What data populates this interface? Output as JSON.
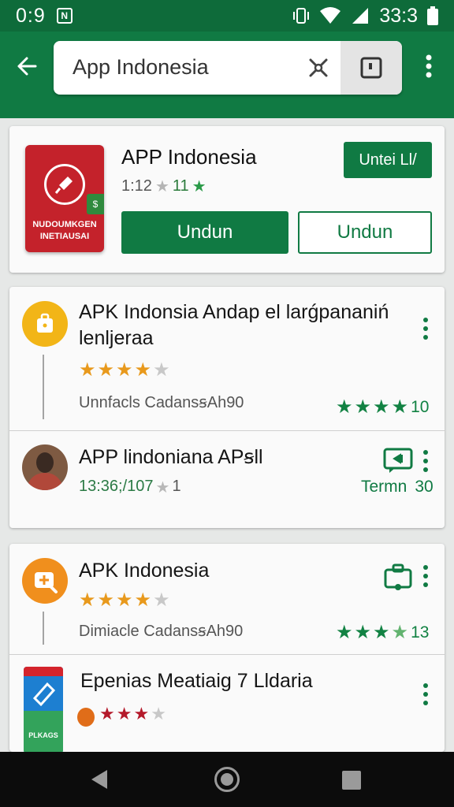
{
  "status_bar": {
    "time": "0:9",
    "notification": "N",
    "clock": "33:3"
  },
  "search": {
    "query": "App Indonesia"
  },
  "featured": {
    "title": "APP Indonesia",
    "meta": "1:12",
    "meta_rating": "11",
    "icon_text": "NUDOUMKGEN INETIAUSAI",
    "icon_badge": "$",
    "small_button": "Untei Ll/",
    "primary_button": "Undun",
    "secondary_button": "Undun"
  },
  "list": [
    {
      "title": "APK Indonsia Andap el larǵpananiń lenljeraa",
      "subtitle": "Unnfacls CadansꞩAh90",
      "rating_stars": 4,
      "right_rating": "10",
      "icon": "briefcase-icon"
    },
    {
      "title": "APP lindoniana APꞩll",
      "subtitle": "13:36;/107",
      "subtitle_suffix": "1",
      "right_label": "Termn",
      "right_value": "30",
      "icon": "avatar"
    },
    {
      "title": "APK Indonesia",
      "subtitle": "Dimiacle CadansꞩAh90",
      "rating_stars": 4,
      "right_rating": "13",
      "icon": "add-icon"
    },
    {
      "title": "Epenias Meatiaig 7 Lldaria",
      "rating_stars": 3,
      "icon_text": "PLKAGS",
      "icon": "app-icon"
    }
  ],
  "colors": {
    "primary": "#107a43",
    "app_bar": "#107a43",
    "status_bar": "#0e6b3a",
    "star_gold": "#e8991c",
    "star_red": "#b4192a"
  }
}
